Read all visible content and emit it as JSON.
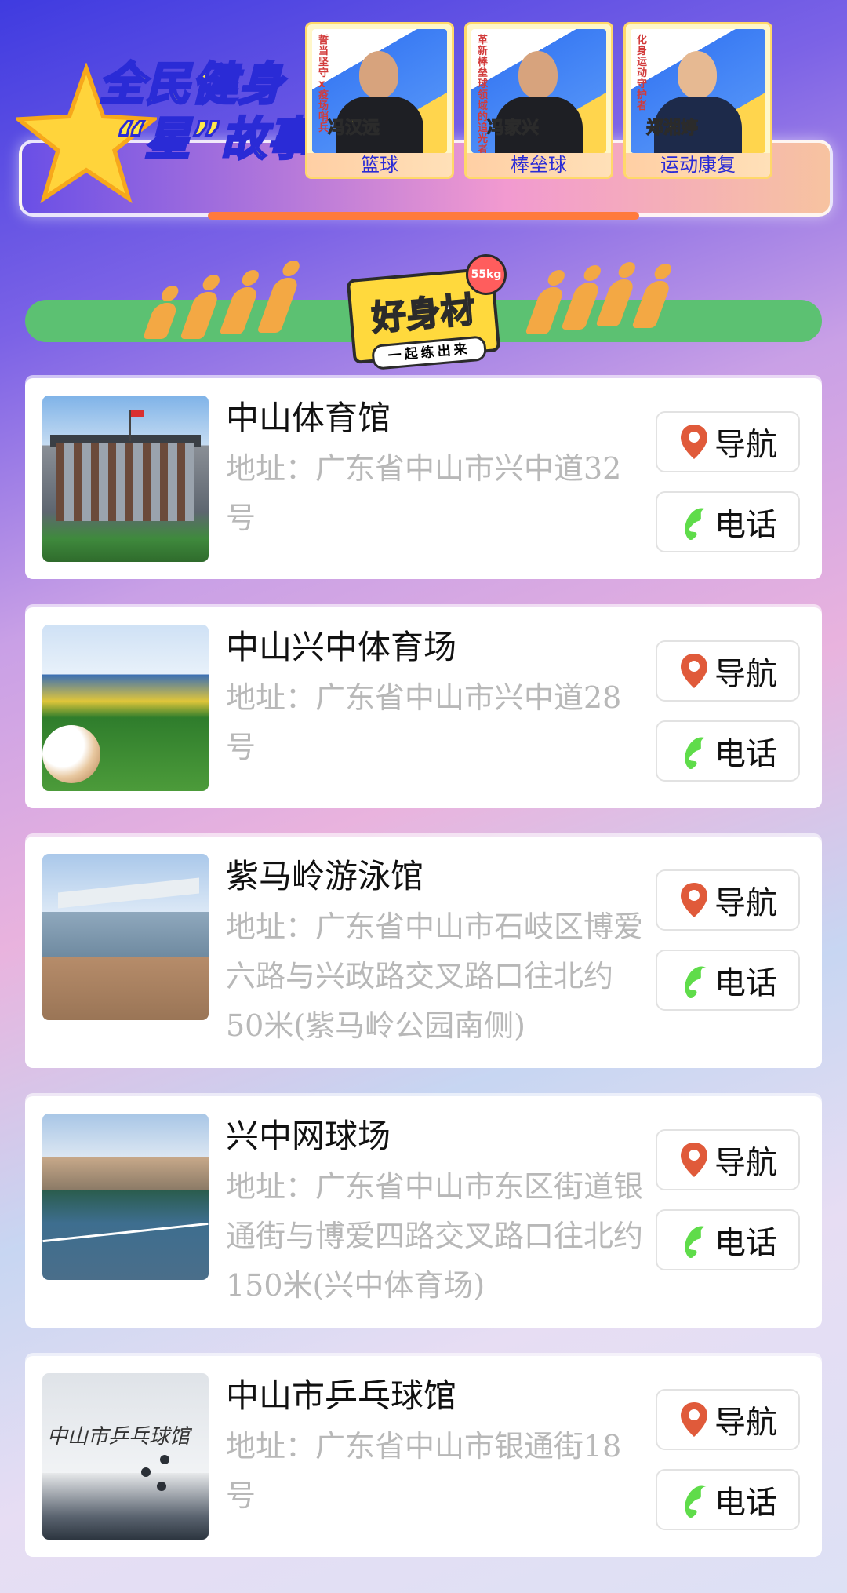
{
  "banner": {
    "title_line1": "全民健身",
    "title_line2": "“星”故事",
    "cards": [
      {
        "name": "冯汉远",
        "category": "篮球",
        "tag": "誓当坚守x疫场哨兵"
      },
      {
        "name": "冯家兴",
        "category": "棒垒球",
        "tag": "革新棒垒球领域的追光者"
      },
      {
        "name": "郑湘婷",
        "category": "运动康复",
        "tag": "化身运动守护者"
      }
    ]
  },
  "hero": {
    "logo_text": "好身材",
    "logo_sub": "一起练出来",
    "kettle_label": "55kg"
  },
  "venues": [
    {
      "name": "中山体育馆",
      "address": "地址：广东省中山市兴中道32号",
      "nav_label": "导航",
      "call_label": "电话"
    },
    {
      "name": "中山兴中体育场",
      "address": "地址：广东省中山市兴中道28号",
      "nav_label": "导航",
      "call_label": "电话"
    },
    {
      "name": "紫马岭游泳馆",
      "address": "地址：广东省中山市石岐区博爱六路与兴政路交叉路口往北约50米(紫马岭公园南侧)",
      "nav_label": "导航",
      "call_label": "电话"
    },
    {
      "name": "兴中网球场",
      "address": "地址：广东省中山市东区街道银通街与博爱四路交叉路口往北约150米(兴中体育场)",
      "nav_label": "导航",
      "call_label": "电话"
    },
    {
      "name": "中山市乒乓球馆",
      "address": "地址：广东省中山市银通街18号",
      "nav_label": "导航",
      "call_label": "电话"
    }
  ],
  "thumb_texts": {
    "tt_sign": "中山市乒乓球馆"
  },
  "colors": {
    "pin": "#e05a3a",
    "phone": "#5fdc4a",
    "green_bar": "#5cc172"
  },
  "icons": {
    "nav": "map-pin-icon",
    "call": "phone-icon"
  }
}
